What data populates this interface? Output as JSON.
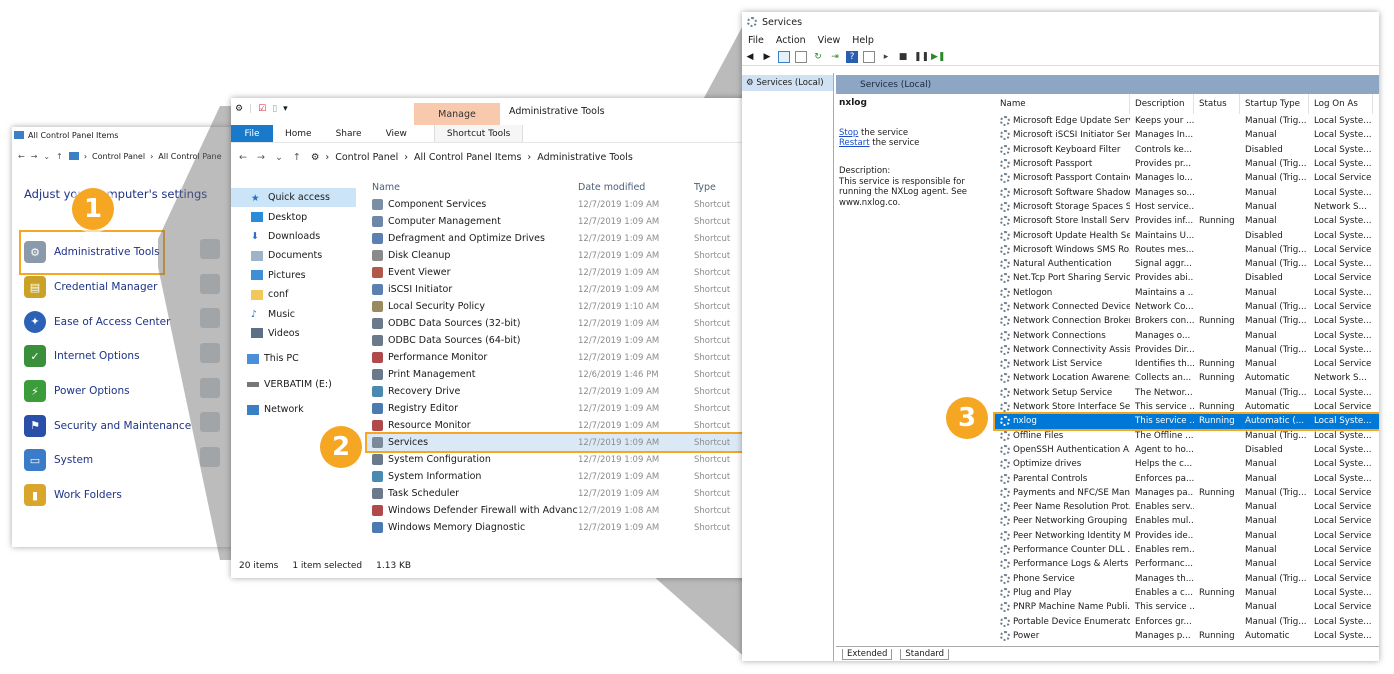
{
  "control_panel": {
    "title": "All Control Panel Items",
    "crumbs": [
      "Control Panel",
      "All Control Pane"
    ],
    "heading": "Adjust your computer's settings",
    "items": [
      {
        "label": "Administrative Tools",
        "icon": "admin-tools-icon",
        "color": "#8a9aab"
      },
      {
        "label": "Credential Manager",
        "icon": "credential-icon",
        "color": "#c9a227"
      },
      {
        "label": "Ease of Access Center",
        "icon": "ease-access-icon",
        "color": "#2b62b8"
      },
      {
        "label": "Internet Options",
        "icon": "internet-icon",
        "color": "#3a8f3a"
      },
      {
        "label": "Power Options",
        "icon": "power-icon",
        "color": "#3b9c3b"
      },
      {
        "label": "Security and Maintenance",
        "icon": "flag-icon",
        "color": "#2a4fa8"
      },
      {
        "label": "System",
        "icon": "system-icon",
        "color": "#3a7cc7"
      },
      {
        "label": "Work Folders",
        "icon": "folder-icon",
        "color": "#d9a52a"
      }
    ]
  },
  "admin_tools": {
    "manage_tab": "Manage",
    "window_title": "Administrative Tools",
    "ribbon": {
      "file": "File",
      "home": "Home",
      "share": "Share",
      "view": "View",
      "shortcut_tools": "Shortcut Tools"
    },
    "crumbs": [
      "Control Panel",
      "All Control Panel Items",
      "Administrative Tools"
    ],
    "nav": {
      "quick_access": "Quick access",
      "items": [
        "Desktop",
        "Downloads",
        "Documents",
        "Pictures",
        "conf",
        "Music",
        "Videos"
      ],
      "this_pc": "This PC",
      "drive": "VERBATIM (E:)",
      "network": "Network"
    },
    "columns": {
      "name": "Name",
      "date": "Date modified",
      "type": "Type"
    },
    "rows": [
      {
        "name": "Component Services",
        "date": "12/7/2019 1:09 AM",
        "type": "Shortcut"
      },
      {
        "name": "Computer Management",
        "date": "12/7/2019 1:09 AM",
        "type": "Shortcut"
      },
      {
        "name": "Defragment and Optimize Drives",
        "date": "12/7/2019 1:09 AM",
        "type": "Shortcut"
      },
      {
        "name": "Disk Cleanup",
        "date": "12/7/2019 1:09 AM",
        "type": "Shortcut"
      },
      {
        "name": "Event Viewer",
        "date": "12/7/2019 1:09 AM",
        "type": "Shortcut"
      },
      {
        "name": "iSCSI Initiator",
        "date": "12/7/2019 1:09 AM",
        "type": "Shortcut"
      },
      {
        "name": "Local Security Policy",
        "date": "12/7/2019 1:10 AM",
        "type": "Shortcut"
      },
      {
        "name": "ODBC Data Sources (32-bit)",
        "date": "12/7/2019 1:09 AM",
        "type": "Shortcut"
      },
      {
        "name": "ODBC Data Sources (64-bit)",
        "date": "12/7/2019 1:09 AM",
        "type": "Shortcut"
      },
      {
        "name": "Performance Monitor",
        "date": "12/7/2019 1:09 AM",
        "type": "Shortcut"
      },
      {
        "name": "Print Management",
        "date": "12/6/2019 1:46 PM",
        "type": "Shortcut"
      },
      {
        "name": "Recovery Drive",
        "date": "12/7/2019 1:09 AM",
        "type": "Shortcut"
      },
      {
        "name": "Registry Editor",
        "date": "12/7/2019 1:09 AM",
        "type": "Shortcut"
      },
      {
        "name": "Resource Monitor",
        "date": "12/7/2019 1:09 AM",
        "type": "Shortcut"
      },
      {
        "name": "Services",
        "date": "12/7/2019 1:09 AM",
        "type": "Shortcut"
      },
      {
        "name": "System Configuration",
        "date": "12/7/2019 1:09 AM",
        "type": "Shortcut"
      },
      {
        "name": "System Information",
        "date": "12/7/2019 1:09 AM",
        "type": "Shortcut"
      },
      {
        "name": "Task Scheduler",
        "date": "12/7/2019 1:09 AM",
        "type": "Shortcut"
      },
      {
        "name": "Windows Defender Firewall with Advanc...",
        "date": "12/7/2019 1:08 AM",
        "type": "Shortcut"
      },
      {
        "name": "Windows Memory Diagnostic",
        "date": "12/7/2019 1:09 AM",
        "type": "Shortcut"
      }
    ],
    "status": {
      "count": "20 items",
      "selected": "1 item selected",
      "size": "1.13 KB"
    }
  },
  "services": {
    "title": "Services",
    "menu": [
      "File",
      "Action",
      "View",
      "Help"
    ],
    "tree_item": "Services (Local)",
    "pane_header": "Services (Local)",
    "selected_name": "nxlog",
    "stop_link": "Stop",
    "stop_rest": " the service",
    "restart_link": "Restart",
    "restart_rest": " the service",
    "description_label": "Description:",
    "description": "This service is responsible for running the NXLog agent. See www.nxlog.co.",
    "columns": {
      "name": "Name",
      "description": "Description",
      "status": "Status",
      "startup": "Startup Type",
      "logon": "Log On As"
    },
    "rows": [
      [
        "Microsoft Edge Update Serv...",
        "Keeps your ...",
        "",
        "Manual (Trig...",
        "Local Syste..."
      ],
      [
        "Microsoft iSCSI Initiator Ser...",
        "Manages In...",
        "",
        "Manual",
        "Local Syste..."
      ],
      [
        "Microsoft Keyboard Filter",
        "Controls ke...",
        "",
        "Disabled",
        "Local Syste..."
      ],
      [
        "Microsoft Passport",
        "Provides pr...",
        "",
        "Manual (Trig...",
        "Local Syste..."
      ],
      [
        "Microsoft Passport Container",
        "Manages lo...",
        "",
        "Manual (Trig...",
        "Local Service"
      ],
      [
        "Microsoft Software Shadow...",
        "Manages so...",
        "",
        "Manual",
        "Local Syste..."
      ],
      [
        "Microsoft Storage Spaces S...",
        "Host service...",
        "",
        "Manual",
        "Network S..."
      ],
      [
        "Microsoft Store Install Service",
        "Provides inf...",
        "Running",
        "Manual",
        "Local Syste..."
      ],
      [
        "Microsoft Update Health Se...",
        "Maintains U...",
        "",
        "Disabled",
        "Local Syste..."
      ],
      [
        "Microsoft Windows SMS Ro...",
        "Routes mes...",
        "",
        "Manual (Trig...",
        "Local Service"
      ],
      [
        "Natural Authentication",
        "Signal aggr...",
        "",
        "Manual (Trig...",
        "Local Syste..."
      ],
      [
        "Net.Tcp Port Sharing Service",
        "Provides abi...",
        "",
        "Disabled",
        "Local Service"
      ],
      [
        "Netlogon",
        "Maintains a ...",
        "",
        "Manual",
        "Local Syste..."
      ],
      [
        "Network Connected Device...",
        "Network Co...",
        "",
        "Manual (Trig...",
        "Local Service"
      ],
      [
        "Network Connection Broker",
        "Brokers con...",
        "Running",
        "Manual (Trig...",
        "Local Syste..."
      ],
      [
        "Network Connections",
        "Manages o...",
        "",
        "Manual",
        "Local Syste..."
      ],
      [
        "Network Connectivity Assis...",
        "Provides Dir...",
        "",
        "Manual (Trig...",
        "Local Syste..."
      ],
      [
        "Network List Service",
        "Identifies th...",
        "Running",
        "Manual",
        "Local Service"
      ],
      [
        "Network Location Awareness",
        "Collects an...",
        "Running",
        "Automatic",
        "Network S..."
      ],
      [
        "Network Setup Service",
        "The Networ...",
        "",
        "Manual (Trig...",
        "Local Syste..."
      ],
      [
        "Network Store Interface Ser...",
        "This service ...",
        "Running",
        "Automatic",
        "Local Service"
      ],
      [
        "nxlog",
        "This service ...",
        "Running",
        "Automatic (...",
        "Local Syste..."
      ],
      [
        "Offline Files",
        "The Offline ...",
        "",
        "Manual (Trig...",
        "Local Syste..."
      ],
      [
        "OpenSSH Authentication A...",
        "Agent to ho...",
        "",
        "Disabled",
        "Local Syste..."
      ],
      [
        "Optimize drives",
        "Helps the c...",
        "",
        "Manual",
        "Local Syste..."
      ],
      [
        "Parental Controls",
        "Enforces pa...",
        "",
        "Manual",
        "Local Syste..."
      ],
      [
        "Payments and NFC/SE Man...",
        "Manages pa...",
        "Running",
        "Manual (Trig...",
        "Local Service"
      ],
      [
        "Peer Name Resolution Prot...",
        "Enables serv...",
        "",
        "Manual",
        "Local Service"
      ],
      [
        "Peer Networking Grouping",
        "Enables mul...",
        "",
        "Manual",
        "Local Service"
      ],
      [
        "Peer Networking Identity M...",
        "Provides ide...",
        "",
        "Manual",
        "Local Service"
      ],
      [
        "Performance Counter DLL ...",
        "Enables rem...",
        "",
        "Manual",
        "Local Service"
      ],
      [
        "Performance Logs & Alerts",
        "Performanc...",
        "",
        "Manual",
        "Local Service"
      ],
      [
        "Phone Service",
        "Manages th...",
        "",
        "Manual (Trig...",
        "Local Service"
      ],
      [
        "Plug and Play",
        "Enables a c...",
        "Running",
        "Manual",
        "Local Syste..."
      ],
      [
        "PNRP Machine Name Publi...",
        "This service ...",
        "",
        "Manual",
        "Local Service"
      ],
      [
        "Portable Device Enumerator...",
        "Enforces gr...",
        "",
        "Manual (Trig...",
        "Local Syste..."
      ],
      [
        "Power",
        "Manages p...",
        "Running",
        "Automatic",
        "Local Syste..."
      ]
    ],
    "selected_index": 21,
    "tabs": [
      "Extended",
      "Standard"
    ]
  },
  "badges": [
    "1",
    "2",
    "3"
  ],
  "colors": {
    "highlight": "#f5a623",
    "selection": "#0078d7"
  }
}
